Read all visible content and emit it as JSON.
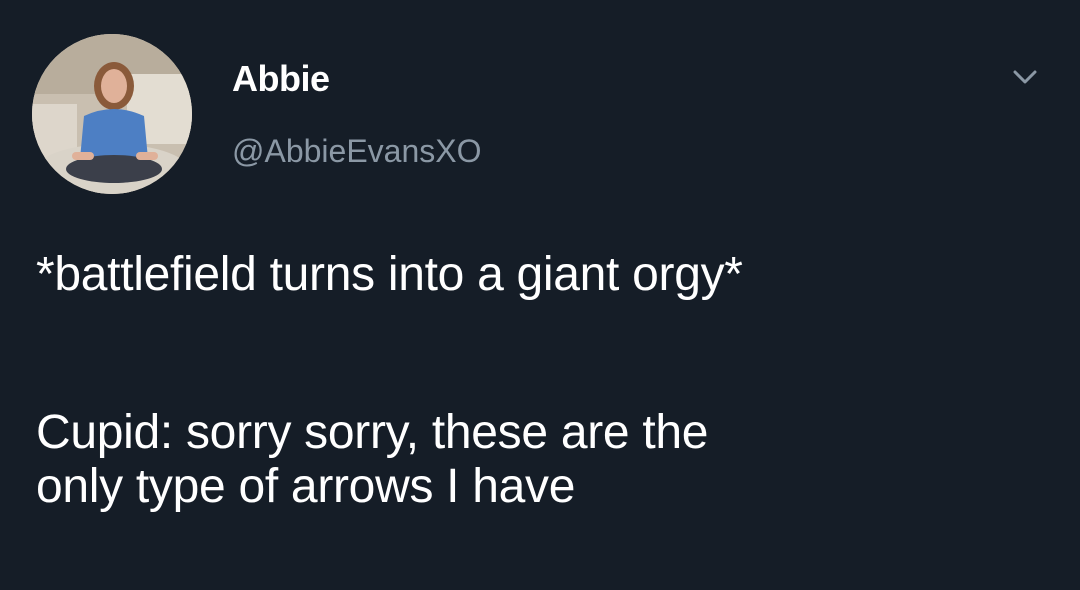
{
  "user": {
    "display_name": "Abbie",
    "handle": "@AbbieEvansXO",
    "avatar_icon": "profile-photo-avatar"
  },
  "menu": {
    "icon": "chevron-down-icon"
  },
  "tweet": {
    "line1": "*battlefield turns into a giant orgy*",
    "line2": "Cupid: sorry sorry, these are the\nonly type of arrows I have"
  },
  "colors": {
    "background": "#151d27",
    "text": "#ffffff",
    "secondary_text": "#8b98a5"
  }
}
